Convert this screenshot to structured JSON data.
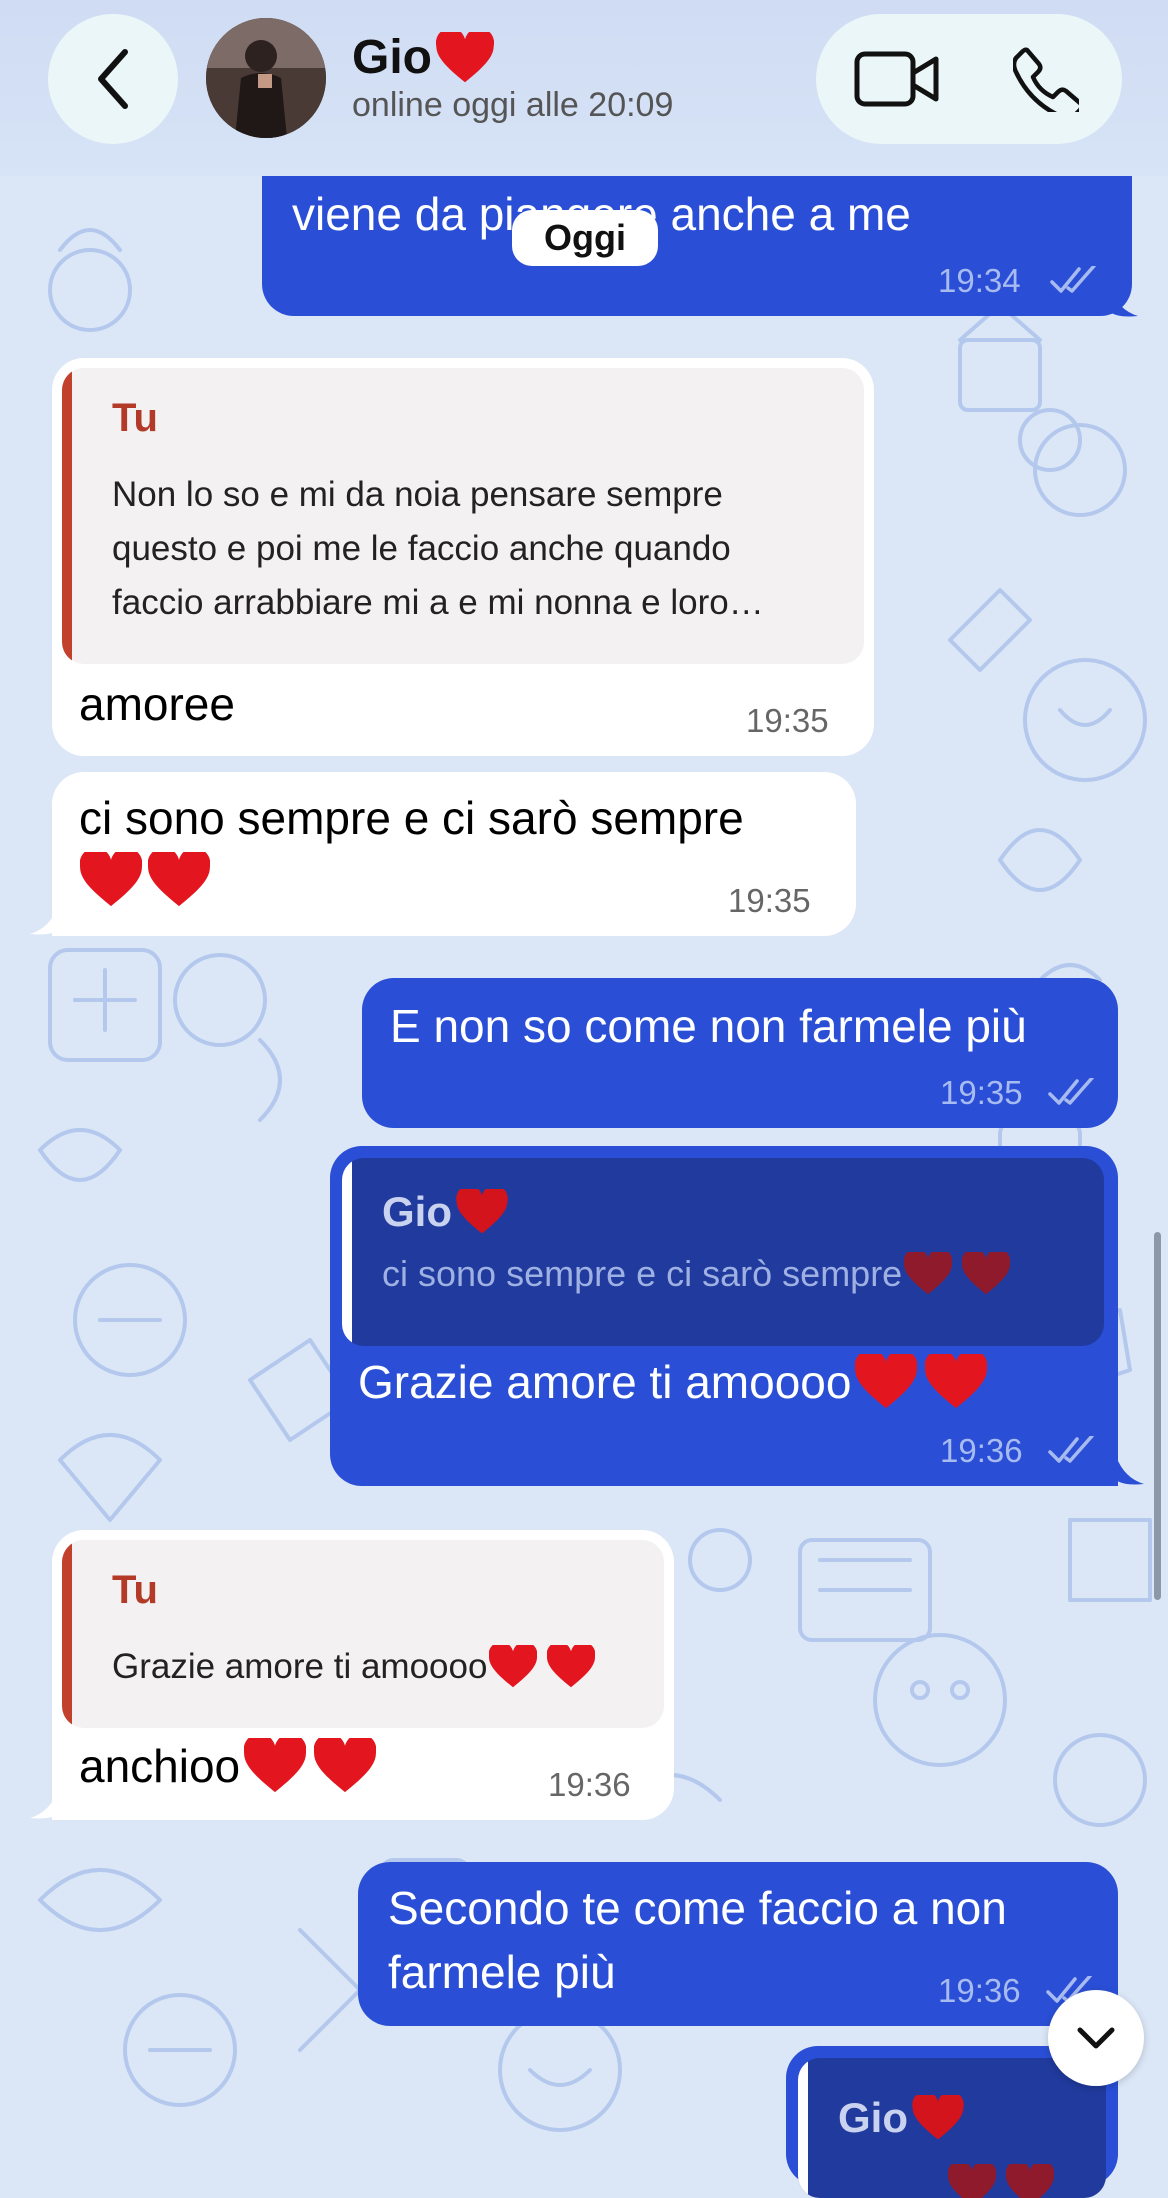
{
  "header": {
    "contact_name": "Gio",
    "status": "online oggi alle 20:09",
    "icons": [
      "back-chevron-icon",
      "video-call-icon",
      "phone-icon",
      "heart-icon"
    ]
  },
  "date_separator": "Oggi",
  "messages": [
    {
      "direction": "out",
      "text": "viene da piangere anche a me",
      "time": "19:34",
      "read": true
    },
    {
      "direction": "in",
      "reply_author": "Tu",
      "reply_lines": [
        "Non lo so e mi da noia pensare sempre",
        "questo e poi me le faccio anche quando",
        "faccio arrabbiare mi a e mi nonna e loro…"
      ],
      "text": "amoree",
      "time": "19:35"
    },
    {
      "direction": "in",
      "text": "ci sono sempre  e ci sarò sempre",
      "hearts": 2,
      "time": "19:35"
    },
    {
      "direction": "out",
      "text": "E non so come non farmele più",
      "time": "19:35",
      "read": true
    },
    {
      "direction": "out",
      "reply_author": "Gio",
      "reply_text": "ci sono sempre  e ci sarò sempre",
      "text": "Grazie amore ti amoooo",
      "hearts": 2,
      "time": "19:36",
      "read": true
    },
    {
      "direction": "in",
      "reply_author": "Tu",
      "reply_text": "Grazie amore ti amoooo",
      "text": "anchioo",
      "hearts": 2,
      "time": "19:36"
    },
    {
      "direction": "out",
      "text_lines": [
        "Secondo te come faccio a non",
        "farmele più"
      ],
      "time": "19:36",
      "read": true
    },
    {
      "direction": "out",
      "reply_author": "Gio",
      "partial": true
    }
  ],
  "colors": {
    "outgoing_bubble": "#2a4fd6",
    "incoming_bubble": "#ffffff",
    "reply_accent_in": "#c2412c",
    "background": "#dbe7f7"
  }
}
